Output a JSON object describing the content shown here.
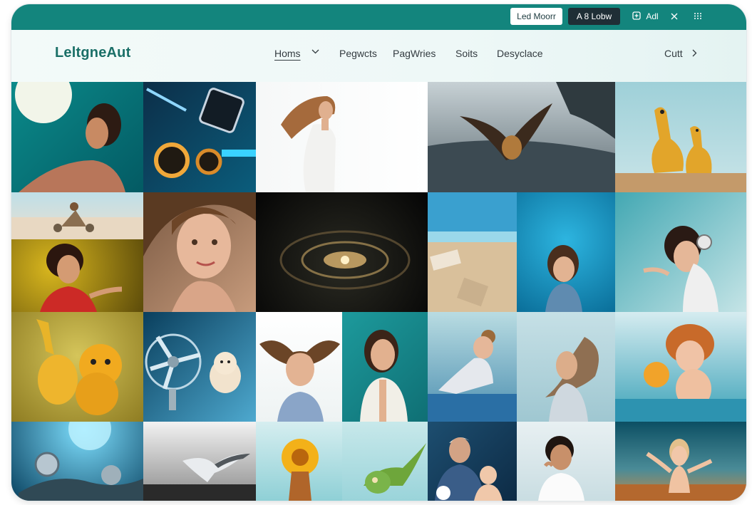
{
  "topbar": {
    "btn_light_label": "Led Moorr",
    "btn_dark_label": "A 8 Lobw",
    "add_label": "Adl",
    "accent": "#13857d"
  },
  "navbar": {
    "logo": "LeltgneAut",
    "items": [
      "Homs",
      "Pegwcts",
      "PagWries",
      "Soits",
      "Desyclace"
    ],
    "cart_label": "Cutt"
  },
  "gallery": {
    "tiles": [
      "woman-teal-sun",
      "lamp-robot-bike",
      "woman-flowing-hair",
      "eagle-over-sea",
      "yellow-plush-birds",
      "beach-bike",
      "girl-long-hair",
      "galaxy-swirl",
      "beach-chairs",
      "girl-blue-overalls",
      "girl-headphones",
      "woman-yellow-bg",
      "plush-dogs-yellow",
      "fan-and-puppy",
      "winged-boy",
      "smiling-girl",
      "girl-sitting-blue",
      "girl-feather-hair",
      "baby-fluffy-hair",
      "robot-parts",
      "seagull-flight",
      "sunflower-creature",
      "green-bird-creature",
      "grandpa-and-baby",
      "boy-white-shirt",
      "girl-waving-desert"
    ]
  }
}
